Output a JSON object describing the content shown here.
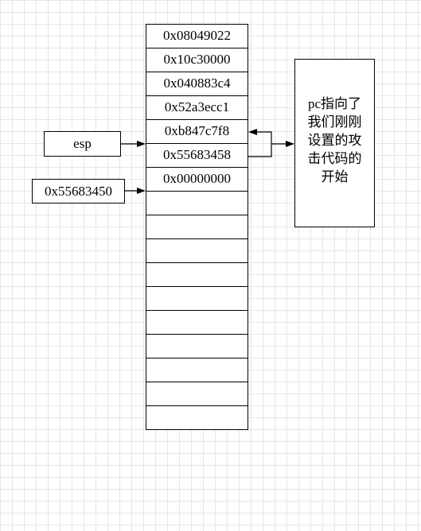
{
  "stack": {
    "cells": [
      "0x08049022",
      "0x10c30000",
      "0x040883c4",
      "0x52a3ecc1",
      "0xb847c7f8",
      "0x55683458",
      "0x00000000",
      "",
      "",
      "",
      "",
      "",
      "",
      "",
      "",
      "",
      ""
    ]
  },
  "labels": {
    "esp": "esp",
    "address": "0x55683450"
  },
  "note": {
    "lines": [
      "pc指向了",
      "我们刚刚",
      "设置的攻",
      "击代码的",
      "开始"
    ]
  }
}
